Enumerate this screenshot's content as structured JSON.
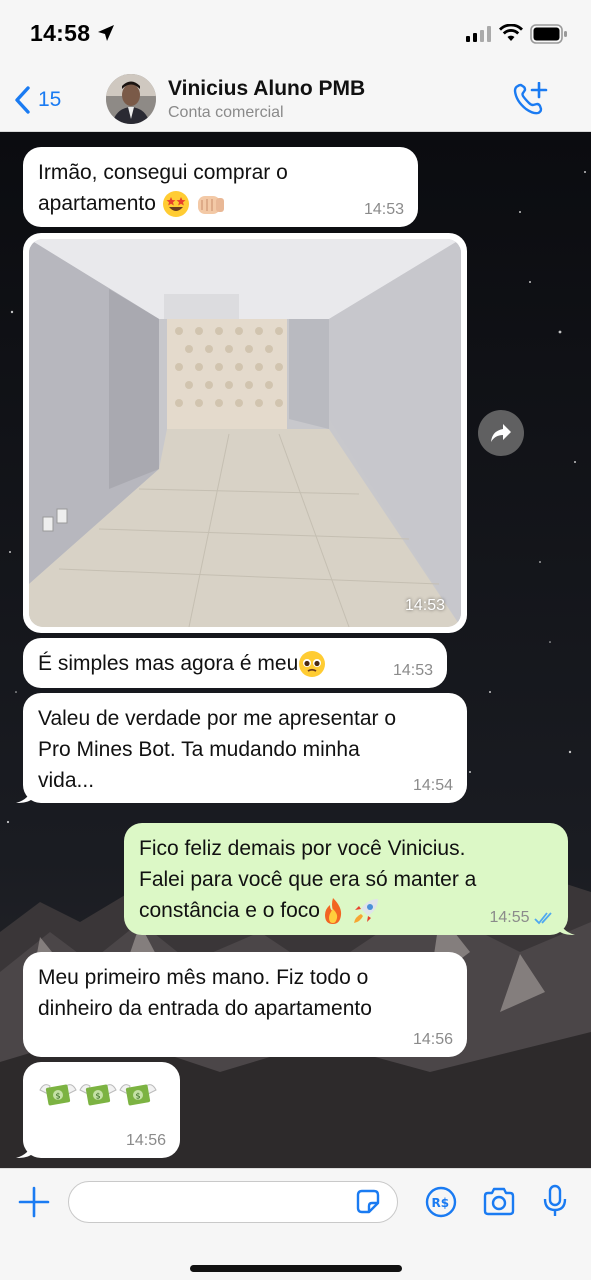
{
  "status_bar": {
    "time": "14:58"
  },
  "header": {
    "back_count": "15",
    "contact_name": "Vinicius Aluno PMB",
    "contact_subtitle": "Conta comercial"
  },
  "messages": [
    {
      "direction": "in",
      "text_lines": [
        "Irmão, consegui comprar o",
        "apartamento"
      ],
      "emojis": [
        "star-struck",
        "fist-bump"
      ],
      "time": "14:53"
    },
    {
      "direction": "in",
      "type": "photo",
      "description": "empty apartment living room",
      "time": "14:53"
    },
    {
      "direction": "in",
      "text": "É simples mas agora é meu",
      "emojis": [
        "pleading-face"
      ],
      "time": "14:53"
    },
    {
      "direction": "in",
      "text_lines": [
        "Valeu de verdade por me apresentar o",
        "Pro Mines Bot. Ta mudando minha",
        "vida..."
      ],
      "time": "14:54"
    },
    {
      "direction": "out",
      "text_lines": [
        "Fico feliz demais por você Vinicius.",
        "Falei para você que era só manter a",
        "constância e o foco"
      ],
      "emojis": [
        "fire",
        "rocket"
      ],
      "time": "14:55",
      "status": "read"
    },
    {
      "direction": "in",
      "text_lines": [
        "Meu primeiro mês mano. Fiz todo o",
        "dinheiro da entrada do apartamento"
      ],
      "time": "14:56"
    },
    {
      "direction": "in",
      "emojis": [
        "money-with-wings",
        "money-with-wings",
        "money-with-wings"
      ],
      "time": "14:56"
    }
  ],
  "input": {
    "placeholder": ""
  },
  "colors": {
    "accent": "#1a7bf2",
    "outgoing_bubble": "#dcf8c6",
    "incoming_bubble": "#ffffff",
    "read_ticks": "#4fa8f0"
  }
}
